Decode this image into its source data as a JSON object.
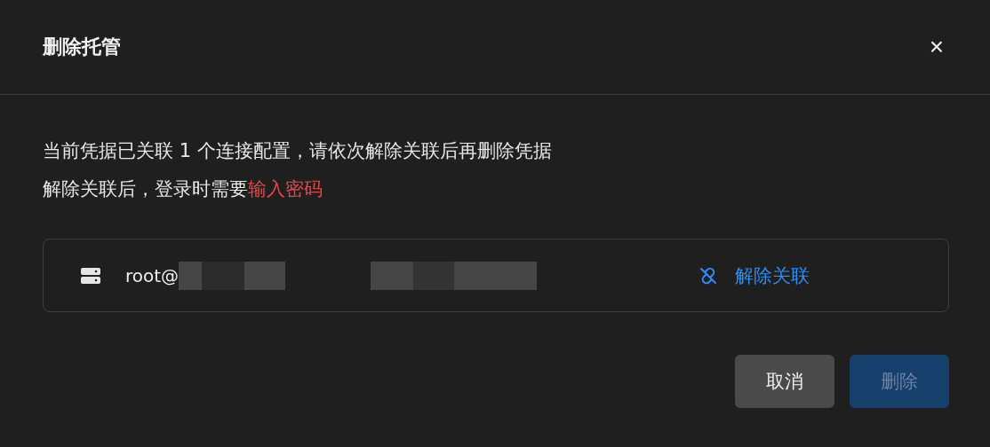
{
  "dialog": {
    "title": "删除托管",
    "close": "×"
  },
  "message": {
    "line_1": "当前凭据已关联 1 个连接配置，请依次解除关联后再删除凭据",
    "line_2": "解除关联后，登录时需要**输入密码**"
  },
  "connections": [
    {
      "label": "root@",
      "redacted": true,
      "action": "解除关联"
    }
  ],
  "buttons": [
    {
      "label": "取消",
      "kind": "secondary",
      "disabled": false
    },
    {
      "label": "删除",
      "kind": "primary",
      "disabled": true
    }
  ]
}
